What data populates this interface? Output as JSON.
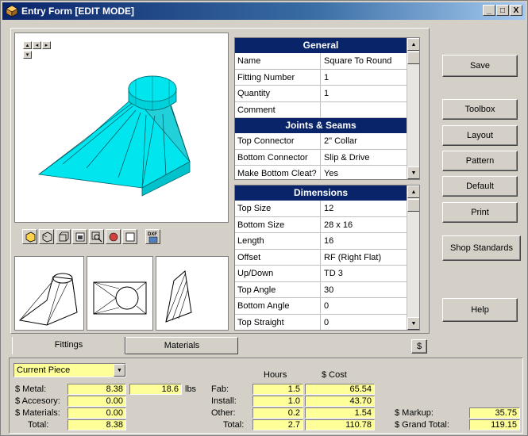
{
  "window": {
    "title": "Entry Form  [EDIT MODE]",
    "controls": {
      "minimize": "_",
      "maximize": "□",
      "close": "X"
    }
  },
  "nav_buttons": [
    "▴",
    "◂",
    "▸",
    "▾"
  ],
  "general_grid": {
    "header": "General",
    "rows": [
      {
        "key": "Name",
        "value": "Square To Round"
      },
      {
        "key": "Fitting Number",
        "value": "1"
      },
      {
        "key": "Quantity",
        "value": "1"
      },
      {
        "key": "Comment",
        "value": ""
      }
    ],
    "subheader": "Joints & Seams",
    "joint_rows": [
      {
        "key": "Top Connector",
        "value": "2\" Collar"
      },
      {
        "key": "Bottom Connector",
        "value": "Slip & Drive"
      },
      {
        "key": "Make Bottom Cleat?",
        "value": "Yes"
      }
    ]
  },
  "dimensions_grid": {
    "header": "Dimensions",
    "rows": [
      {
        "key": "Top Size",
        "value": "12"
      },
      {
        "key": "Bottom Size",
        "value": "28 x  16"
      },
      {
        "key": "Length",
        "value": "16"
      },
      {
        "key": "Offset",
        "value": "RF (Right Flat)"
      },
      {
        "key": "Up/Down",
        "value": "TD 3"
      },
      {
        "key": "Top Angle",
        "value": "30"
      },
      {
        "key": "Bottom Angle",
        "value": "0"
      },
      {
        "key": "Top Straight",
        "value": "0"
      }
    ]
  },
  "buttons": {
    "save": "Save",
    "toolbox": "Toolbox",
    "layout": "Layout",
    "pattern": "Pattern",
    "default": "Default",
    "print": "Print",
    "shop_standards": "Shop Standards",
    "help": "Help"
  },
  "toolbar_icons": [
    "solid-view-icon",
    "wire-view-icon",
    "iso-view-icon",
    "front-view-icon",
    "zoom-view-icon",
    "shade-view-icon",
    "flat-view-icon",
    "dxf-export-icon"
  ],
  "dxf_label": "DXF",
  "tabs": {
    "fittings": "Fittings",
    "materials": "Materials",
    "dollar": "$"
  },
  "summary": {
    "piece_select": "Current Piece",
    "metal_label": "$ Metal:",
    "metal_value": "8.38",
    "weight_value": "18.6",
    "weight_unit": "lbs",
    "accessory_label": "$ Accesory:",
    "accessory_value": "0.00",
    "materials_label": "$ Materials:",
    "materials_value": "0.00",
    "total_label": "Total:",
    "total_value": "8.38",
    "hours_header": "Hours",
    "cost_header": "$ Cost",
    "fab_label": "Fab:",
    "fab_hours": "1.5",
    "fab_cost": "65.54",
    "install_label": "Install:",
    "install_hours": "1.0",
    "install_cost": "43.70",
    "other_label": "Other:",
    "other_hours": "0.2",
    "other_cost": "1.54",
    "total2_label": "Total:",
    "total_hours": "2.7",
    "total_cost": "110.78",
    "markup_label": "$ Markup:",
    "markup_value": "35.75",
    "grand_total_label": "$ Grand Total:",
    "grand_total_value": "119.15"
  },
  "colors": {
    "header_bg": "#0a246a",
    "field_bg": "#ffff99",
    "fitting_fill": "#00e5ee",
    "window_bg": "#d4d0c8"
  }
}
